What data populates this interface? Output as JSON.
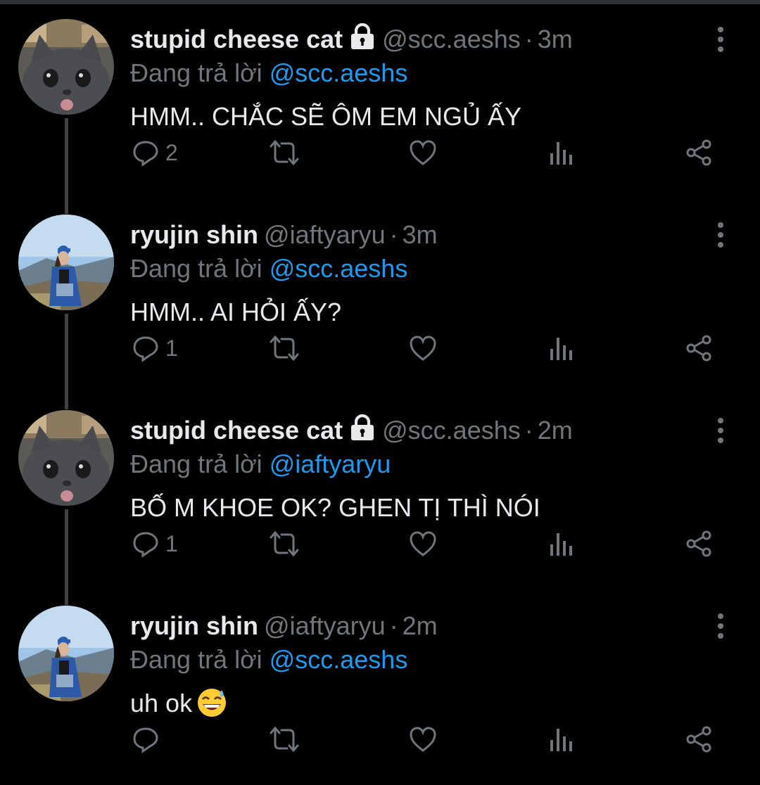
{
  "tweets": [
    {
      "name": "stupid cheese cat",
      "locked": true,
      "handle": "@scc.aeshs",
      "dot": "·",
      "time": "3m",
      "replying_prefix": "Đang trả lời",
      "replying_to": "@scc.aeshs",
      "text": "HMM.. CHẮC SẼ ÔM EM NGỦ ẤY",
      "reply_count": "2",
      "avatar": "cat-avatar"
    },
    {
      "name": "ryujin shin",
      "locked": false,
      "handle": "@iaftyaryu",
      "dot": "·",
      "time": "3m",
      "replying_prefix": "Đang trả lời",
      "replying_to": "@scc.aeshs",
      "text": "HMM.. AI HỎI ẤY?",
      "reply_count": "1",
      "avatar": "girl-avatar"
    },
    {
      "name": "stupid cheese cat",
      "locked": true,
      "handle": "@scc.aeshs",
      "dot": "·",
      "time": "2m",
      "replying_prefix": "Đang trả lời",
      "replying_to": "@iaftyaryu",
      "text": "BỐ M KHOE OK? GHEN TỊ THÌ NÓI",
      "reply_count": "1",
      "avatar": "cat-avatar"
    },
    {
      "name": "ryujin shin",
      "locked": false,
      "handle": "@iaftyaryu",
      "dot": "·",
      "time": "2m",
      "replying_prefix": "Đang trả lời",
      "replying_to": "@scc.aeshs",
      "text": "uh ok",
      "emoji": "grinning-face-with-sweat",
      "reply_count": "",
      "avatar": "girl-avatar"
    }
  ],
  "colors": {
    "background": "#000000",
    "text": "#e7e9ea",
    "secondary": "#71767b",
    "link": "#1d9bf0",
    "thread_line": "#3e4144"
  }
}
